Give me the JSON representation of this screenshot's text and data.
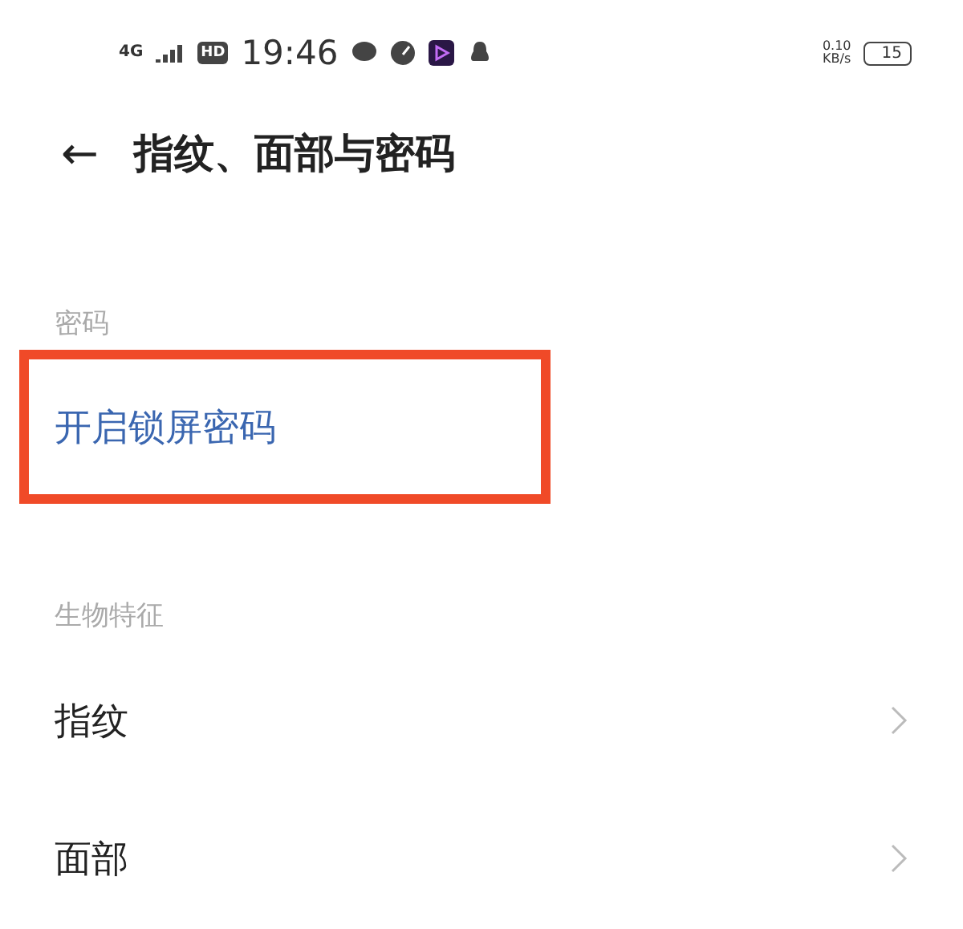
{
  "status_bar": {
    "network": "4G",
    "hd": "HD",
    "time": "19:46",
    "speed": "0.10",
    "speed_unit": "KB/s",
    "battery": "15"
  },
  "header": {
    "back": "←",
    "title": "指纹、面部与密码"
  },
  "sections": [
    {
      "title": "密码",
      "items": [
        {
          "label": "开启锁屏密码",
          "kind": "action",
          "highlighted": true
        }
      ]
    },
    {
      "title": "生物特征",
      "items": [
        {
          "label": "指纹",
          "kind": "nav",
          "highlighted": false
        },
        {
          "label": "面部",
          "kind": "nav",
          "highlighted": false
        }
      ]
    }
  ]
}
